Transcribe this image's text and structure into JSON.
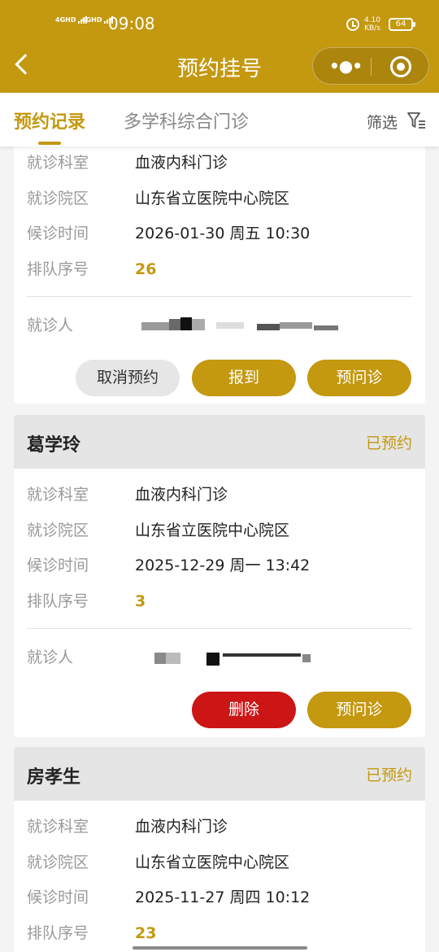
{
  "status_bar": {
    "signal1": "4GHD",
    "signal2": "4GHD",
    "time": "09:08",
    "net_speed_value": "4.10",
    "net_speed_unit": "KB/s",
    "battery": "64"
  },
  "header": {
    "title": "预约挂号",
    "back_icon": "chevron-left-icon",
    "more_icon": "more-dots-icon",
    "close_icon": "target-circle-icon"
  },
  "tabs": [
    {
      "label": "预约记录",
      "active": true
    },
    {
      "label": "多学科综合门诊",
      "active": false
    }
  ],
  "filter": {
    "label": "筛选",
    "icon": "filter-funnel-icon"
  },
  "labels": {
    "department": "就诊科室",
    "campus": "就诊院区",
    "wait_time": "候诊时间",
    "queue_no": "排队序号",
    "patient": "就诊人"
  },
  "records": [
    {
      "department": "血液内科门诊",
      "campus": "山东省立医院中心院区",
      "wait_time": "2026-01-30  周五  10:30",
      "queue_no": "26",
      "buttons": [
        "取消预约",
        "报到",
        "预问诊"
      ]
    },
    {
      "name": "葛学玲",
      "status": "已预约",
      "department": "血液内科门诊",
      "campus": "山东省立医院中心院区",
      "wait_time": "2025-12-29  周一  13:42",
      "queue_no": "3",
      "buttons": [
        "删除",
        "预问诊"
      ]
    },
    {
      "name": "房孝生",
      "status": "已预约",
      "department": "血液内科门诊",
      "campus": "山东省立医院中心院区",
      "wait_time": "2025-11-27  周四  10:12",
      "queue_no": "23"
    }
  ],
  "colors": {
    "brand": "#c4980f",
    "danger": "#cc1515",
    "card_header": "#e5e5e5"
  }
}
